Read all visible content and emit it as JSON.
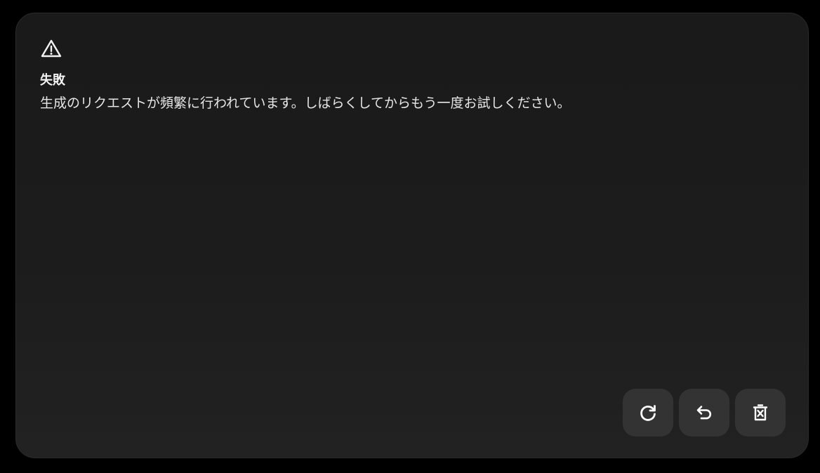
{
  "dialog": {
    "icon": "warning-triangle-icon",
    "title": "失敗",
    "message": "生成のリクエストが頻繁に行われています。しばらくしてからもう一度お試しください。"
  },
  "actions": [
    {
      "icon": "retry-icon"
    },
    {
      "icon": "undo-icon"
    },
    {
      "icon": "delete-icon"
    }
  ],
  "colors": {
    "background": "#000000",
    "card": "#1c1c1c",
    "button": "#333333",
    "text": "#e6e6e6"
  }
}
